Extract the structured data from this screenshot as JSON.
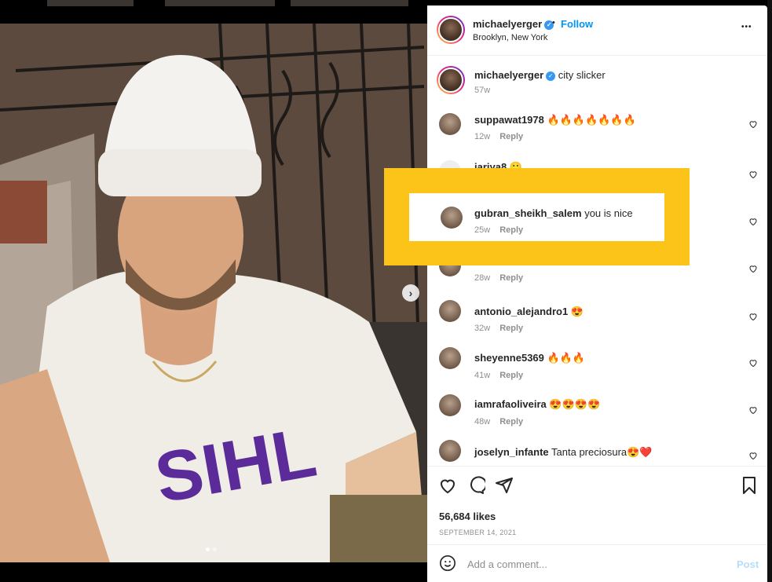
{
  "post": {
    "username": "michaelyerger",
    "location": "Brooklyn, New York",
    "follow_label": "Follow",
    "separator": "•",
    "more_label": "•••",
    "caption": "city slicker",
    "caption_age": "57w"
  },
  "comments": [
    {
      "user": "suppawat1978",
      "text": "🔥🔥🔥🔥🔥🔥🔥",
      "age": "12w",
      "reply": "Reply"
    },
    {
      "user": "jariya8",
      "text": "🙂",
      "age": "",
      "reply": ""
    },
    {
      "user": "gubran_sheikh_salem",
      "text": "you is nice",
      "age": "25w",
      "reply": "Reply"
    },
    {
      "user": "",
      "text": "",
      "age": "28w",
      "reply": "Reply"
    },
    {
      "user": "antonio_alejandro1",
      "text": "😍",
      "age": "32w",
      "reply": "Reply"
    },
    {
      "user": "sheyenne5369",
      "text": "🔥🔥🔥",
      "age": "41w",
      "reply": "Reply"
    },
    {
      "user": "iamrafaoliveira",
      "text": "😍😍😍😍",
      "age": "48w",
      "reply": "Reply"
    },
    {
      "user": "joselyn_infante",
      "text": "Tanta preciosura😍❤️",
      "age": "",
      "reply": ""
    }
  ],
  "actions": {
    "likes": "56,684 likes",
    "date": "SEPTEMBER 14, 2021"
  },
  "add_comment": {
    "placeholder": "Add a comment...",
    "post_label": "Post"
  },
  "colors": {
    "highlight": "#fcc419",
    "link_blue": "#0095f6",
    "verified_blue": "#3897f0"
  }
}
